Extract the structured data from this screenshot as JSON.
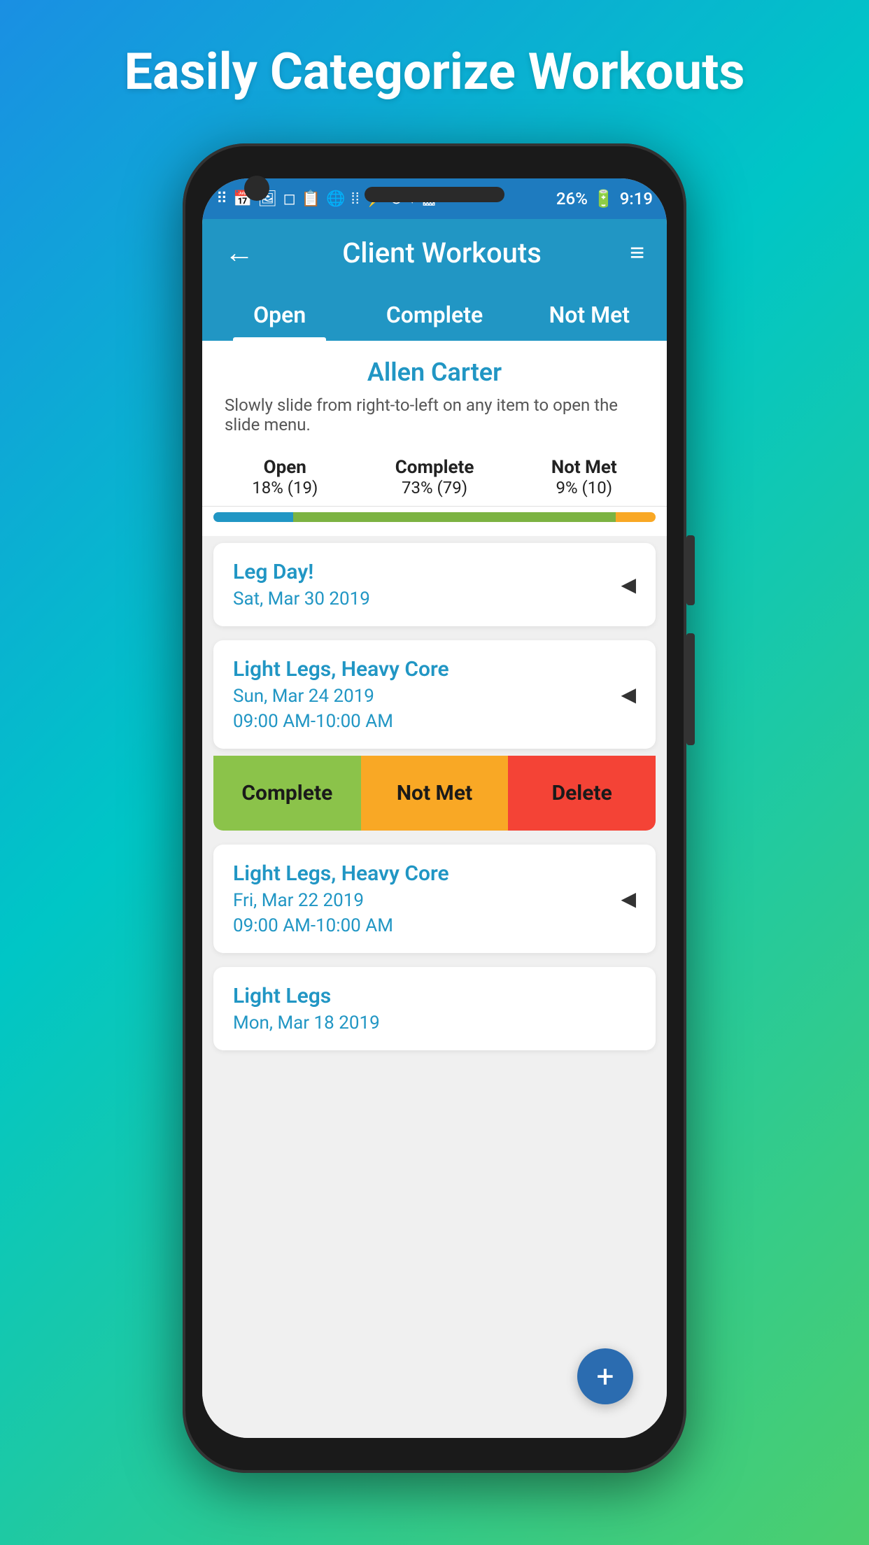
{
  "page": {
    "headline": "Easily Categorize Workouts"
  },
  "status_bar": {
    "time": "9:19",
    "battery": "26%"
  },
  "header": {
    "title": "Client Workouts",
    "back_label": "←",
    "filter_label": "≡"
  },
  "tabs": [
    {
      "id": "open",
      "label": "Open",
      "active": true
    },
    {
      "id": "complete",
      "label": "Complete",
      "active": false
    },
    {
      "id": "not_met",
      "label": "Not Met",
      "active": false
    }
  ],
  "client": {
    "name": "Allen Carter",
    "hint": "Slowly slide from right-to-left on any item to open the slide menu."
  },
  "stats": {
    "open": {
      "label": "Open",
      "percent": "18%",
      "count": "(19)"
    },
    "complete": {
      "label": "Complete",
      "percent": "73%",
      "count": "(79)"
    },
    "not_met": {
      "label": "Not Met",
      "percent": "9%",
      "count": "(10)"
    }
  },
  "progress": {
    "open_width": 18,
    "complete_width": 73,
    "not_met_width": 9
  },
  "workouts": [
    {
      "id": 1,
      "title": "Leg Day!",
      "date": "Sat, Mar 30 2019",
      "time": null,
      "show_slide": false
    },
    {
      "id": 2,
      "title": "Light Legs, Heavy Core",
      "date": "Sun, Mar 24 2019",
      "time": "09:00 AM-10:00 AM",
      "show_slide": true
    },
    {
      "id": 3,
      "title": "Light Legs, Heavy Core",
      "date": "Fri, Mar 22 2019",
      "time": "09:00 AM-10:00 AM",
      "show_slide": false
    },
    {
      "id": 4,
      "title": "Light Legs",
      "date": "Mon, Mar 18 2019",
      "time": null,
      "show_slide": false
    }
  ],
  "slide_menu": {
    "complete": "Complete",
    "not_met": "Not Met",
    "delete": "Delete"
  },
  "fab": {
    "label": "+"
  }
}
